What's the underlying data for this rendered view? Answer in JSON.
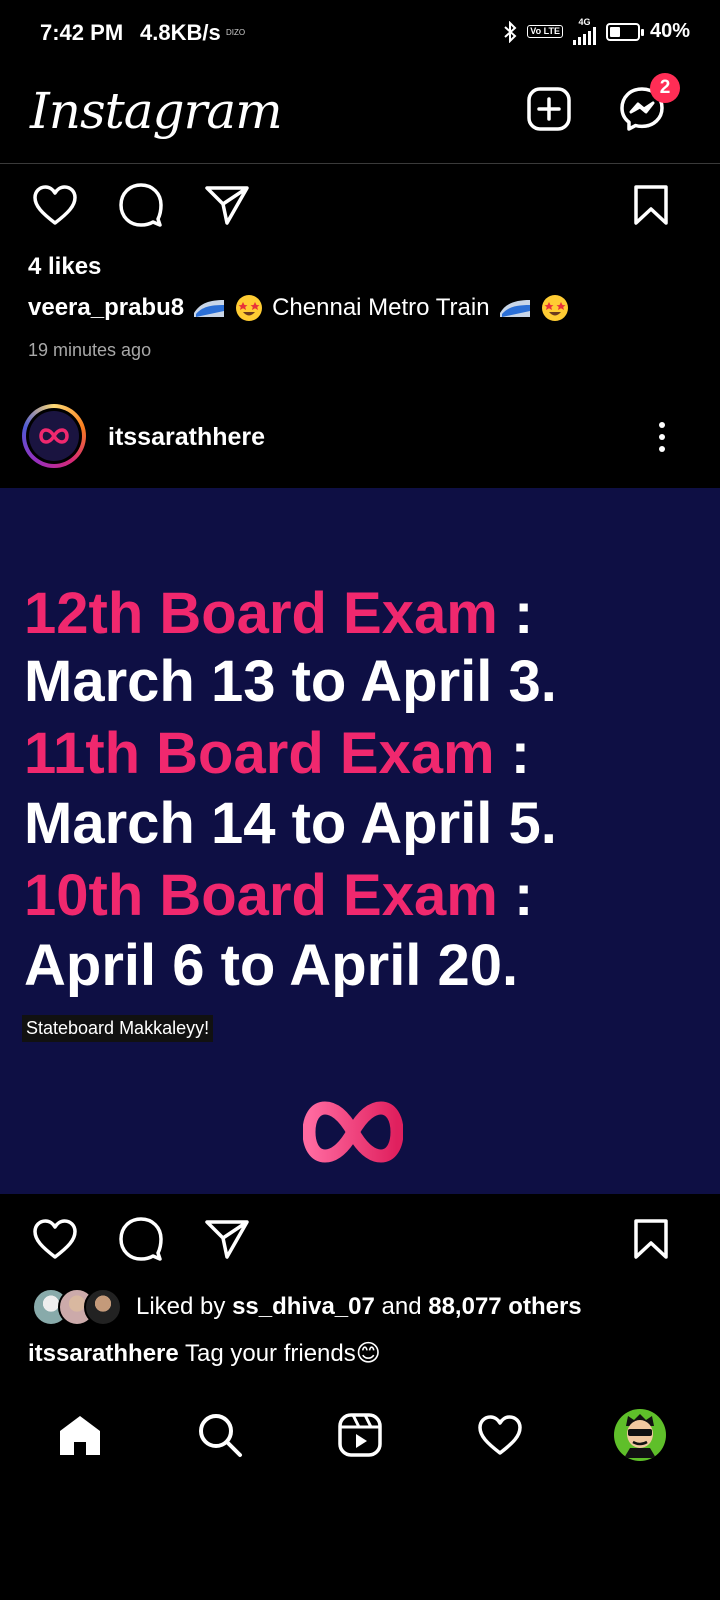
{
  "status_bar": {
    "time": "7:42 PM",
    "speed": "4.8KB/s",
    "speed_tag": "DIZO",
    "network": "4G",
    "volte": "Vo LTE",
    "battery": "40%",
    "battery_level": 0.4
  },
  "header": {
    "logo": "Instagram",
    "messages_badge": "2"
  },
  "prev_post": {
    "likes": "4 likes",
    "username": "veera_prabu8",
    "caption": "Chennai Metro Train",
    "time_ago": "19 minutes ago"
  },
  "post": {
    "username": "itssarathhere",
    "image_lines": [
      {
        "text": "12th Board Exam",
        "suffix": " :"
      },
      {
        "text": "March 13 to April 3."
      },
      {
        "text": "11th Board Exam",
        "suffix": " :"
      },
      {
        "text": "March 14 to April 5."
      },
      {
        "text": "10th Board Exam",
        "suffix": " :"
      },
      {
        "text": "April 6 to April 20."
      }
    ],
    "image_tagline": "Stateboard Makkaleyy!",
    "liked_prefix": "Liked by ",
    "liked_by": "ss_dhiva_07",
    "liked_mid": " and ",
    "liked_others": "88,077 others",
    "caption": "Tag your friends😊"
  },
  "colors": {
    "accent_pink": "#f0286e",
    "post_bg": "#0e0f44",
    "badge": "#ff2d55"
  },
  "icons": {
    "prev_actions": [
      "heart-icon",
      "comment-icon",
      "share-icon",
      "bookmark-icon"
    ],
    "nav": [
      "home-icon",
      "search-icon",
      "reels-icon",
      "activity-heart-icon",
      "profile-avatar"
    ]
  }
}
